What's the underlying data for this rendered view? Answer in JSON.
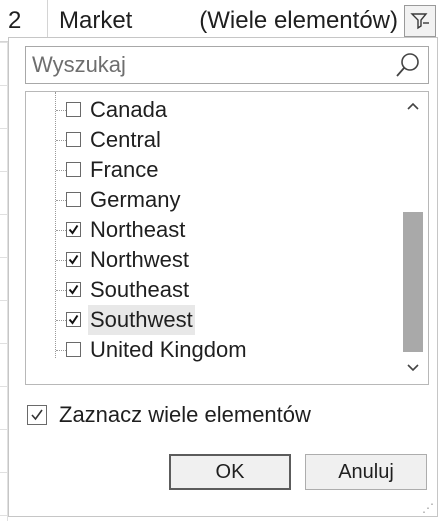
{
  "header": {
    "row_number": "2",
    "field_label": "Market",
    "field_value": "(Wiele elementów)"
  },
  "search": {
    "placeholder": "Wyszukaj"
  },
  "list": {
    "items": [
      {
        "label": "Canada",
        "checked": false
      },
      {
        "label": "Central",
        "checked": false
      },
      {
        "label": "France",
        "checked": false
      },
      {
        "label": "Germany",
        "checked": false
      },
      {
        "label": "Northeast",
        "checked": true
      },
      {
        "label": "Northwest",
        "checked": true
      },
      {
        "label": "Southeast",
        "checked": true
      },
      {
        "label": "Southwest",
        "checked": true
      },
      {
        "label": "United Kingdom",
        "checked": false
      }
    ]
  },
  "multi_select": {
    "label": "Zaznacz wiele elementów",
    "checked": true
  },
  "buttons": {
    "ok": "OK",
    "cancel": "Anuluj"
  },
  "icons": {
    "filter": "filter-icon",
    "search": "search-icon",
    "scroll_up": "chevron-up-icon",
    "scroll_down": "chevron-down-icon",
    "resize": "resize-grip-icon"
  }
}
